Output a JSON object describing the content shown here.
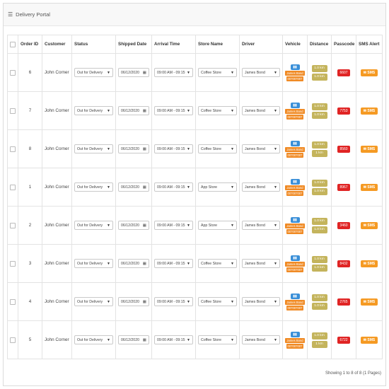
{
  "panel": {
    "title": "Delivery Portal",
    "icon": "list-icon"
  },
  "table": {
    "headers": [
      "Order ID",
      "Customer",
      "Status",
      "Shipped Date",
      "Arrival Time",
      "Store Name",
      "Driver",
      "Vehicle",
      "Distance",
      "Passcode",
      "SMS Alert"
    ],
    "rows": [
      {
        "order_id": "6",
        "customer": "John Corner",
        "status": "Out for Delivery",
        "shipped_date": "06/12/2020",
        "arrival_time": "09:00 AM - 09:15",
        "store": "Coffee Store",
        "driver": "James Bond",
        "vehicle_driver": "James Bond",
        "vehicle_code": "007007007",
        "distance1": "1.0 km",
        "distance2": "1.0 km",
        "passcode": "6607",
        "sms": "SMS"
      },
      {
        "order_id": "7",
        "customer": "John Corner",
        "status": "Out for Delivery",
        "shipped_date": "06/12/2020",
        "arrival_time": "09:00 AM - 09:15",
        "store": "Coffee Store",
        "driver": "James Bond",
        "vehicle_driver": "James Bond",
        "vehicle_code": "007007007",
        "distance1": "1.0 km",
        "distance2": "1.0 km",
        "passcode": "7753",
        "sms": "SMS"
      },
      {
        "order_id": "8",
        "customer": "John Corner",
        "status": "Out for Delivery",
        "shipped_date": "06/12/2020",
        "arrival_time": "09:00 AM - 09:15",
        "store": "Coffee Store",
        "driver": "James Bond",
        "vehicle_driver": "James Bond",
        "vehicle_code": "007007007",
        "distance1": "1.0 km",
        "distance2": "1 km",
        "passcode": "8560",
        "sms": "SMS"
      },
      {
        "order_id": "1",
        "customer": "John Corner",
        "status": "Out for Delivery",
        "shipped_date": "06/12/2020",
        "arrival_time": "09:00 AM - 09:15",
        "store": "App Store",
        "driver": "James Bond",
        "vehicle_driver": "James Bond",
        "vehicle_code": "007007007",
        "distance1": "1.0 km",
        "distance2": "1.0 km",
        "passcode": "8967",
        "sms": "SMS"
      },
      {
        "order_id": "2",
        "customer": "John Corner",
        "status": "Out for Delivery",
        "shipped_date": "06/12/2020",
        "arrival_time": "09:00 AM - 09:15",
        "store": "App Store",
        "driver": "James Bond",
        "vehicle_driver": "James Bond",
        "vehicle_code": "007007007",
        "distance1": "1.0 km",
        "distance2": "1.0 km",
        "passcode": "3460",
        "sms": "SMS"
      },
      {
        "order_id": "3",
        "customer": "John Corner",
        "status": "Out for Delivery",
        "shipped_date": "06/12/2020",
        "arrival_time": "09:00 AM - 09:15",
        "store": "Coffee Store",
        "driver": "James Bond",
        "vehicle_driver": "James Bond",
        "vehicle_code": "007007007",
        "distance1": "1.0 km",
        "distance2": "1.0 km",
        "passcode": "8432",
        "sms": "SMS"
      },
      {
        "order_id": "4",
        "customer": "John Corner",
        "status": "Out for Delivery",
        "shipped_date": "06/12/2020",
        "arrival_time": "09:00 AM - 09:15",
        "store": "Coffee Store",
        "driver": "James Bond",
        "vehicle_driver": "James Bond",
        "vehicle_code": "007007007",
        "distance1": "1.0 km",
        "distance2": "1.0 km",
        "passcode": "2765",
        "sms": "SMS"
      },
      {
        "order_id": "5",
        "customer": "John Corner",
        "status": "Out for Delivery",
        "shipped_date": "06/12/2020",
        "arrival_time": "09:00 AM - 09:15",
        "store": "Coffee Store",
        "driver": "James Bond",
        "vehicle_driver": "James Bond",
        "vehicle_code": "007007007",
        "distance1": "1.0 km",
        "distance2": "1 km",
        "passcode": "6722",
        "sms": "SMS"
      }
    ]
  },
  "footer": {
    "info": "Showing 1 to 8 of 8 (1 Pages)"
  },
  "colors": {
    "vehicle": "#3a8fd8",
    "vehicle_tag": "#f08a24",
    "distance": "#c4b45c",
    "passcode": "#e02424",
    "sms": "#f59a23"
  }
}
